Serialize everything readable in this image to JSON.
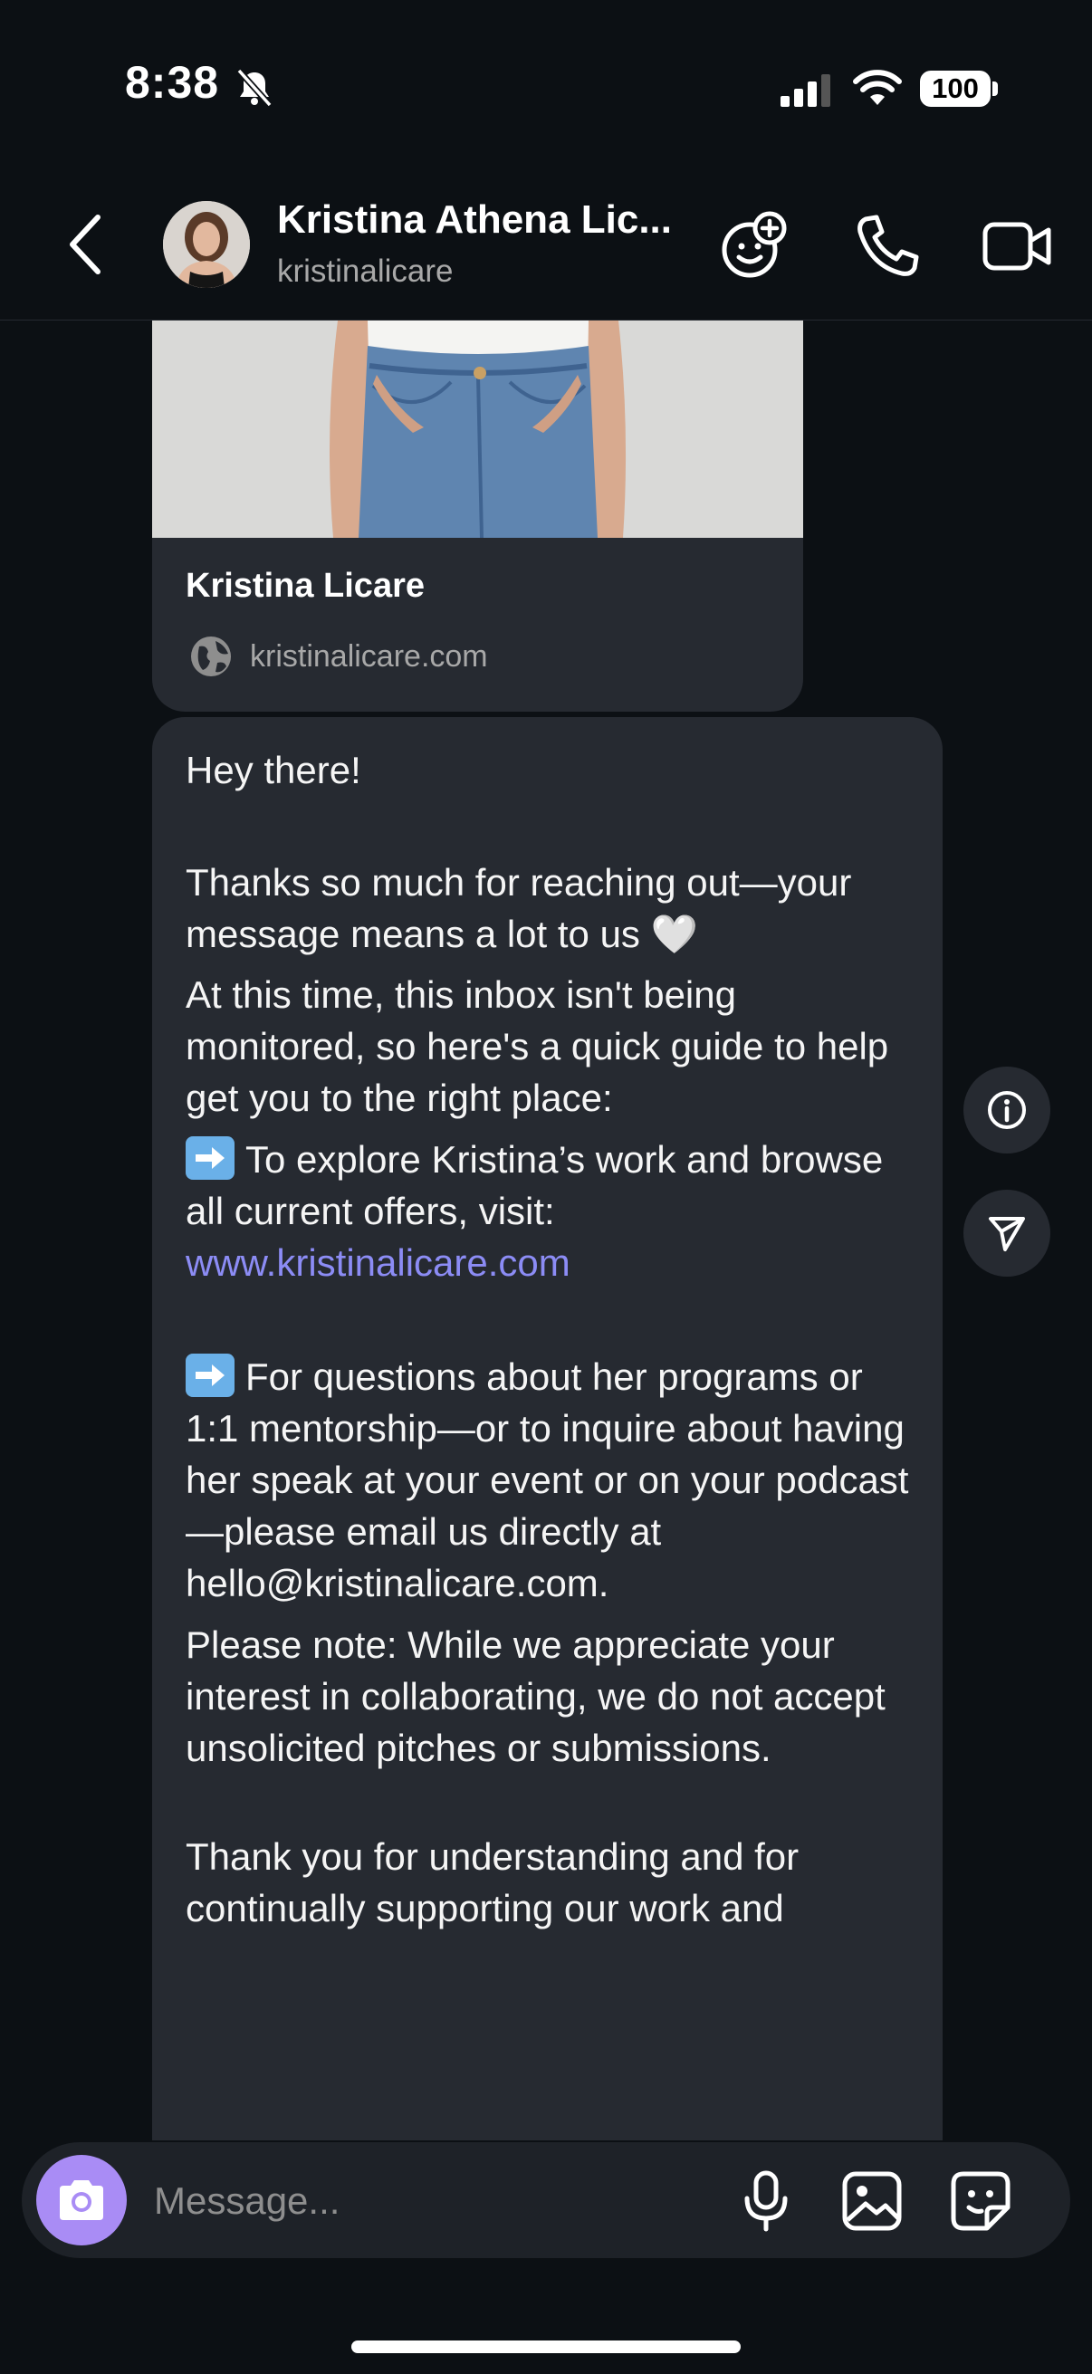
{
  "status_bar": {
    "time": "8:38",
    "battery": "100"
  },
  "header": {
    "contact_name": "Kristina Athena Lic...",
    "contact_handle": "kristinalicare"
  },
  "link_card": {
    "title": "Kristina Licare",
    "domain": "kristinalicare.com"
  },
  "message": {
    "greeting": "Hey there!",
    "thanks": "Thanks so much for reaching out—your message means a lot to us 🤍",
    "inbox_note": "At this time, this inbox isn't being monitored, so here's a quick guide to help get you to the right place:",
    "explore_text": "To explore Kristina’s work and browse all current offers, visit:",
    "explore_link": "www.kristinalicare.com",
    "questions_text": "For questions about her programs or 1:1 mentorship—or to inquire about having her speak at your event or on your podcast—please email us directly at hello@kristinalicare.com.",
    "note": "Please note: While we appreciate your interest in collaborating, we do not accept unsolicited pitches or submissions.",
    "closing": "Thank you for understanding and for continually supporting our work and"
  },
  "composer": {
    "placeholder": "Message..."
  },
  "colors": {
    "background": "#0c1014",
    "bubble": "#262a31",
    "link": "#8c8cf5",
    "camera": "#a98cf5"
  },
  "icons": [
    "bell-slash-icon",
    "signal-icon",
    "wifi-icon",
    "back-icon",
    "add-reaction-icon",
    "phone-icon",
    "video-icon",
    "globe-icon",
    "arrow-right-emoji",
    "info-icon",
    "send-icon",
    "camera-icon",
    "microphone-icon",
    "gallery-icon",
    "sticker-icon"
  ]
}
